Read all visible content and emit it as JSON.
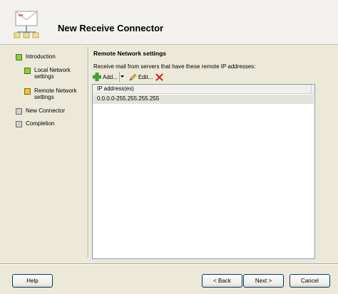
{
  "header": {
    "title": "New Receive Connector",
    "icon": "connector-envelope-icon"
  },
  "nav": {
    "items": [
      {
        "label": "Introduction",
        "state": "complete"
      },
      {
        "label": "Local Network settings",
        "state": "complete"
      },
      {
        "label": "Remote Network settings",
        "state": "current"
      },
      {
        "label": "New Connector",
        "state": "pending"
      },
      {
        "label": "Completion",
        "state": "pending"
      }
    ]
  },
  "main": {
    "section_title": "Remote Network settings",
    "description": "Receive mail from servers that have these remote IP addresses:",
    "toolbar": {
      "add_label": "Add...",
      "edit_label": "Edit...",
      "add_icon": "green-plus-icon",
      "edit_icon": "pencil-icon",
      "remove_icon": "red-x-icon"
    },
    "list": {
      "column_header": "IP address(es)",
      "rows": [
        "0.0.0.0-255.255.255.255"
      ]
    }
  },
  "footer": {
    "help_label": "Help",
    "back_label": "< Back",
    "next_label": "Next >",
    "cancel_label": "Cancel"
  },
  "colors": {
    "complete": "#8fcc3e",
    "current": "#f0c23a",
    "pending": "#d4d0c8",
    "background": "#ece9d8"
  }
}
